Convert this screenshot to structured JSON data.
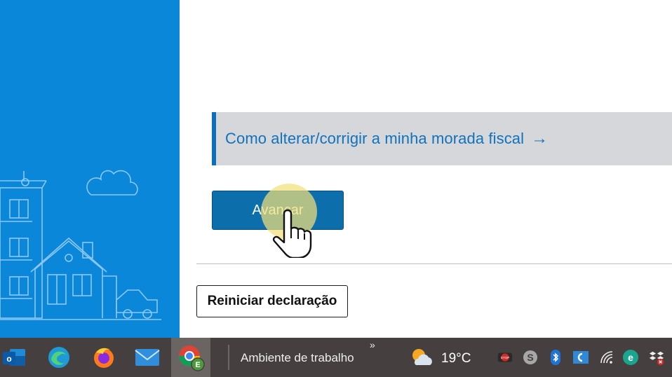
{
  "main": {
    "help_link": {
      "text": "Como alterar/corrigir a minha morada fiscal",
      "arrow": "→"
    },
    "primary_button": {
      "label": "Avançar"
    },
    "secondary_button": {
      "label": "Reiniciar declaração"
    }
  },
  "taskbar": {
    "apps": [
      {
        "name": "Outlook",
        "icon": "outlook-icon"
      },
      {
        "name": "Microsoft Edge",
        "icon": "edge-icon"
      },
      {
        "name": "Firefox",
        "icon": "firefox-icon"
      },
      {
        "name": "Mail",
        "icon": "mail-icon"
      },
      {
        "name": "Google Chrome",
        "icon": "chrome-icon",
        "badge": "E",
        "active": true
      }
    ],
    "desktop_toolbar_label": "Ambiente de trabalho",
    "chevron": "»",
    "weather": {
      "icon": "partly-cloudy-icon",
      "temperature": "19°C"
    },
    "tray_icons": [
      "stop-icon",
      "skype-icon",
      "bluetooth-icon",
      "network-app-icon",
      "wifi-icon",
      "eset-icon",
      "dropbox-icon"
    ]
  },
  "colors": {
    "side_panel": "#0a87d9",
    "link": "#1172bd",
    "primary_button": "#0d6eac",
    "taskbar": "#45403f"
  }
}
